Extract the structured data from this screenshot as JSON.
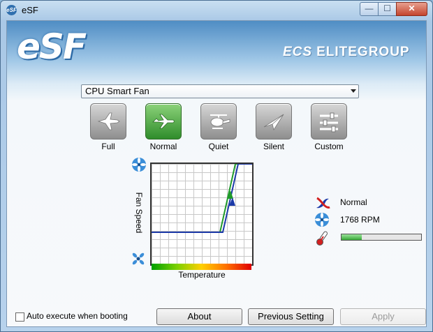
{
  "window": {
    "title": "eSF",
    "icon": "esf-app-icon",
    "minimize": "—",
    "maximize": "☐",
    "close": "✕"
  },
  "header": {
    "logo_text": "eSF",
    "brand_mark": "ECS",
    "brand_name": "ELITEGROUP"
  },
  "profile_select": {
    "value": "CPU Smart Fan"
  },
  "modes": [
    {
      "id": "full",
      "label": "Full",
      "icon": "fighter-jet-icon",
      "active": false
    },
    {
      "id": "normal",
      "label": "Normal",
      "icon": "airliner-icon",
      "active": true
    },
    {
      "id": "quiet",
      "label": "Quiet",
      "icon": "helicopter-icon",
      "active": false
    },
    {
      "id": "silent",
      "label": "Silent",
      "icon": "paper-plane-icon",
      "active": false
    },
    {
      "id": "custom",
      "label": "Custom",
      "icon": "sliders-icon",
      "active": false
    }
  ],
  "graph": {
    "ylabel": "Fan Speed",
    "xlabel": "Temperature"
  },
  "status": {
    "mode": "Normal",
    "rpm": "1768 RPM",
    "temperature_fraction": 0.25
  },
  "footer": {
    "auto_execute_label": "Auto execute when booting",
    "auto_execute_checked": false,
    "about": "About",
    "previous_setting": "Previous Setting",
    "apply": "Apply"
  },
  "colors": {
    "active_mode": "#3a9a34",
    "curve_green": "#1f9a2a",
    "curve_blue": "#1c3aa8"
  }
}
